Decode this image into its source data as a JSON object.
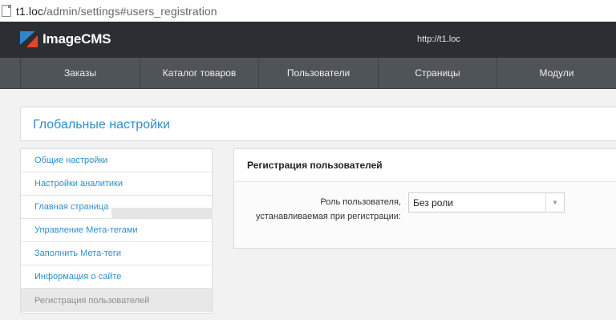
{
  "browser": {
    "url_host": "t1.loc",
    "url_path": "/admin/settings#users_registration"
  },
  "header": {
    "logo_text": "ImageCMS",
    "site_link": "http://t1.loc"
  },
  "nav": {
    "items": [
      {
        "label": "Заказы"
      },
      {
        "label": "Каталог товаров"
      },
      {
        "label": "Пользователи"
      },
      {
        "label": "Страницы"
      },
      {
        "label": "Модули"
      }
    ]
  },
  "page": {
    "title": "Глобальные настройки"
  },
  "sidebar": {
    "items": [
      {
        "label": "Общие настройки"
      },
      {
        "label": "Настройки аналитики"
      },
      {
        "label": "Главная страница"
      },
      {
        "label": "Управление Мета-тегами"
      },
      {
        "label": "Заполнить Мета-теги"
      },
      {
        "label": "Информация о сайте"
      },
      {
        "label": "Регистрация пользователей",
        "active": true
      }
    ]
  },
  "panel": {
    "heading": "Регистрация пользователей",
    "field_label_line1": "Роль пользователя,",
    "field_label_line2": "устанавливаемая при регистрации:",
    "role_select_value": "Без роли"
  },
  "colors": {
    "accent": "#2e8fca",
    "topbar": "#2b2e32",
    "navbar": "#4f5459"
  }
}
